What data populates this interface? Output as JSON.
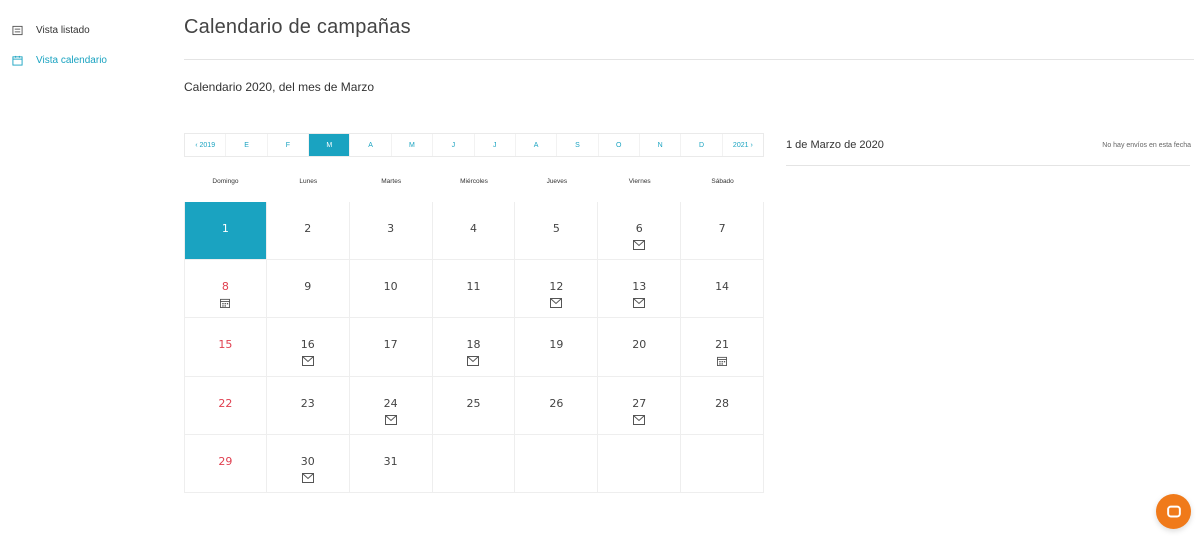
{
  "sidebar": {
    "items": [
      {
        "label": "Vista listado",
        "icon": "list-icon"
      },
      {
        "label": "Vista calendario",
        "icon": "calendar-icon"
      }
    ]
  },
  "header": {
    "title": "Calendario de campañas",
    "subtitle": "Calendario 2020, del mes de Marzo"
  },
  "month_nav": {
    "prev": "‹ 2019",
    "months": [
      "E",
      "F",
      "M",
      "A",
      "M",
      "J",
      "J",
      "A",
      "S",
      "O",
      "N",
      "D"
    ],
    "active_index": 2,
    "next": "2021 ›"
  },
  "weekdays": [
    "Domingo",
    "Lunes",
    "Martes",
    "Miércoles",
    "Jueves",
    "Viernes",
    "Sábado"
  ],
  "days": [
    {
      "n": "1",
      "event": null,
      "today": true
    },
    {
      "n": "2",
      "event": null
    },
    {
      "n": "3",
      "event": null
    },
    {
      "n": "4",
      "event": null
    },
    {
      "n": "5",
      "event": null
    },
    {
      "n": "6",
      "event": "envelope-icon"
    },
    {
      "n": "7",
      "event": null
    },
    {
      "n": "8",
      "event": "calendar-icon"
    },
    {
      "n": "9",
      "event": null
    },
    {
      "n": "10",
      "event": null
    },
    {
      "n": "11",
      "event": null
    },
    {
      "n": "12",
      "event": "envelope-icon"
    },
    {
      "n": "13",
      "event": "envelope-icon"
    },
    {
      "n": "14",
      "event": null
    },
    {
      "n": "15",
      "event": null
    },
    {
      "n": "16",
      "event": "envelope-icon"
    },
    {
      "n": "17",
      "event": null
    },
    {
      "n": "18",
      "event": "envelope-icon"
    },
    {
      "n": "19",
      "event": null
    },
    {
      "n": "20",
      "event": null
    },
    {
      "n": "21",
      "event": "calendar-icon"
    },
    {
      "n": "22",
      "event": null
    },
    {
      "n": "23",
      "event": null
    },
    {
      "n": "24",
      "event": "envelope-icon"
    },
    {
      "n": "25",
      "event": null
    },
    {
      "n": "26",
      "event": null
    },
    {
      "n": "27",
      "event": "envelope-icon"
    },
    {
      "n": "28",
      "event": null
    },
    {
      "n": "29",
      "event": null
    },
    {
      "n": "30",
      "event": "envelope-icon"
    },
    {
      "n": "31",
      "event": null
    }
  ],
  "detail": {
    "date_title": "1 de Marzo de 2020",
    "empty_text": "No hay envíos en esta fecha"
  },
  "colors": {
    "accent": "#1aa3c1",
    "sunday": "#e04050",
    "chat": "#f07a1a"
  },
  "chat": {
    "icon": "chat-icon"
  }
}
